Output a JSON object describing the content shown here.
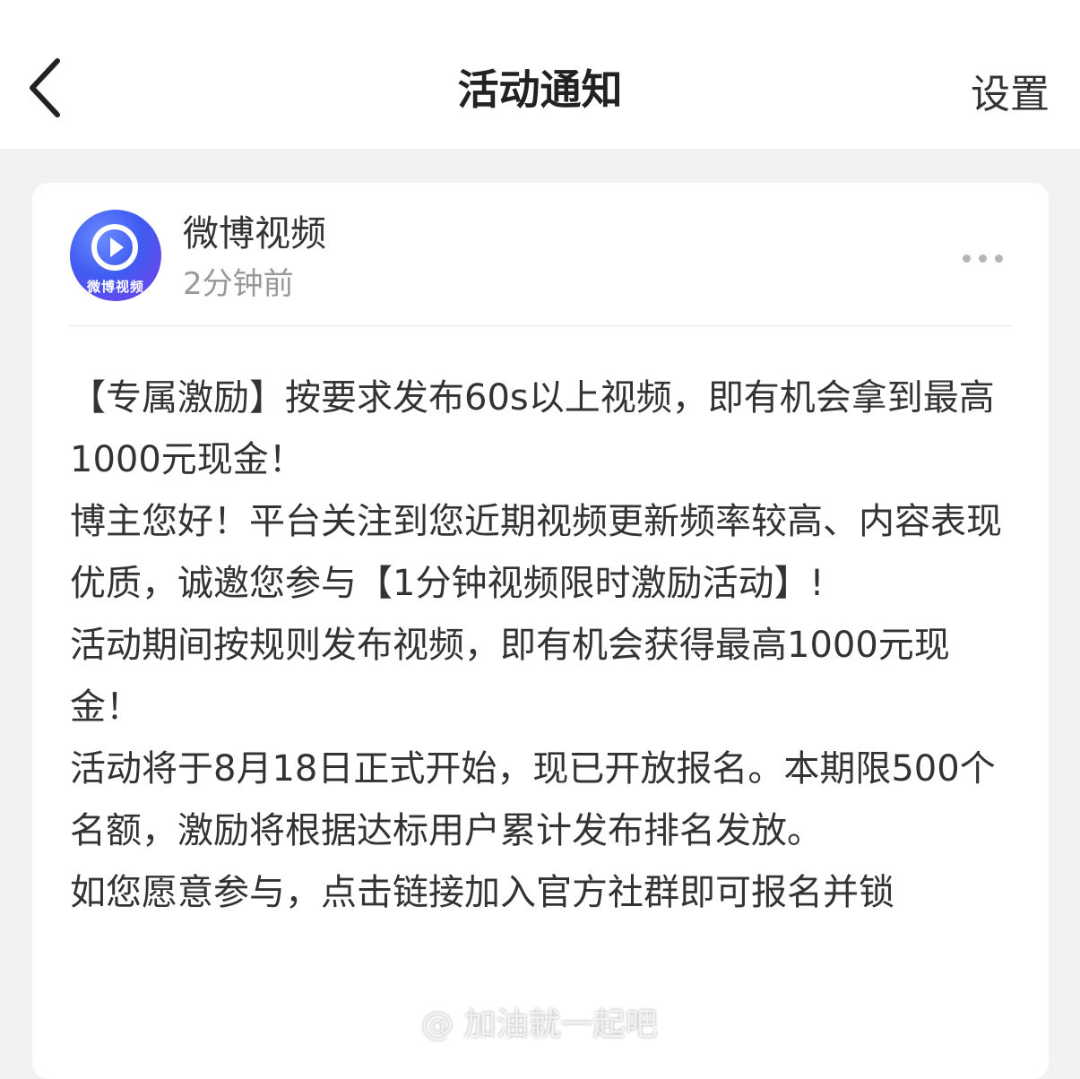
{
  "header": {
    "back_icon": "chevron-left-icon",
    "title": "活动通知",
    "settings_label": "设置"
  },
  "message": {
    "sender_name": "微博视频",
    "avatar_label": "微博视频",
    "avatar_colors": [
      "#3f5cf0",
      "#7a3fe8"
    ],
    "time": "2分钟前",
    "more_icon": "more-dots-icon",
    "paragraphs": [
      "【专属激励】按要求发布60s以上视频，即有机会拿到最高1000元现金！",
      "博主您好！平台关注到您近期视频更新频率较高、内容表现优质，诚邀您参与【1分钟视频限时激励活动】!",
      "活动期间按规则发布视频，即有机会获得最高1000元现金！",
      "活动将于8月18日正式开始，现已开放报名。本期限500个名额，激励将根据达标用户累计发布排名发放。",
      "如您愿意参与，点击链接加入官方社群即可报名并锁"
    ]
  },
  "watermark": "@ 加油就一起吧"
}
